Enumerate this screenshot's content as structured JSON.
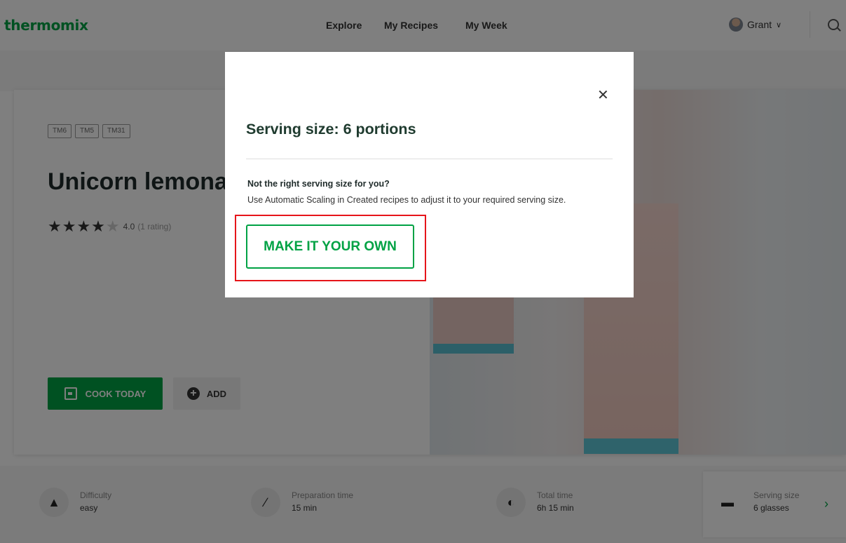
{
  "header": {
    "logo": "thermomix",
    "nav": [
      "Explore",
      "My Recipes",
      "My Week"
    ],
    "user_name": "Grant"
  },
  "recipe": {
    "tags": [
      "TM6",
      "TM5",
      "TM31"
    ],
    "title": "Unicorn lemona",
    "rating_value": "4.0",
    "rating_count": "(1 rating)",
    "stars_filled": 4,
    "cook_today_label": "COOK TODAY",
    "add_label": "ADD"
  },
  "info": [
    {
      "label": "Difficulty",
      "value": "easy",
      "icon": "chef-hat-icon"
    },
    {
      "label": "Preparation time",
      "value": "15 min",
      "icon": "knife-icon"
    },
    {
      "label": "Total time",
      "value": "6h 15 min",
      "icon": "timer-icon"
    },
    {
      "label": "Serving size",
      "value": "6 glasses",
      "icon": "serving-icon"
    }
  ],
  "modal": {
    "title": "Serving size: 6 portions",
    "question": "Not the right serving size for you?",
    "description": "Use Automatic Scaling in Created recipes to adjust it to your required serving size.",
    "button_label": "MAKE IT YOUR OWN"
  },
  "colors": {
    "brand": "#00a244",
    "highlight": "#e6151a",
    "overlay": "rgba(0,0,0,0.5)"
  }
}
